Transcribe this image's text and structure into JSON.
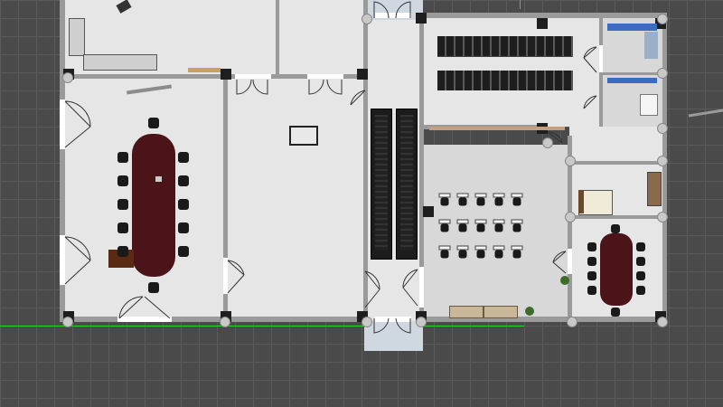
{
  "app": {
    "view": "floor-plan-2d",
    "captions": {
      "tv_screen": "",
      "scale": ""
    }
  },
  "colors": {
    "background": "#4a4a4a",
    "grid": "#5a5a5a",
    "floor": "#e6e6e6",
    "wall": "#9a9a9a",
    "conference_table": "#4a1418",
    "axis": "#2bd92b"
  },
  "rooms": [
    {
      "id": "office-top-left"
    },
    {
      "id": "boardroom-left"
    },
    {
      "id": "open-hall"
    },
    {
      "id": "escalator-lobby"
    },
    {
      "id": "lab-top-right"
    },
    {
      "id": "classroom"
    },
    {
      "id": "storage-right"
    },
    {
      "id": "bedroom-small"
    },
    {
      "id": "meeting-room-right"
    }
  ],
  "icons": {
    "escalator": "escalator-icon",
    "plant": "plant-icon",
    "bed": "bed-icon",
    "door": "door-icon"
  }
}
